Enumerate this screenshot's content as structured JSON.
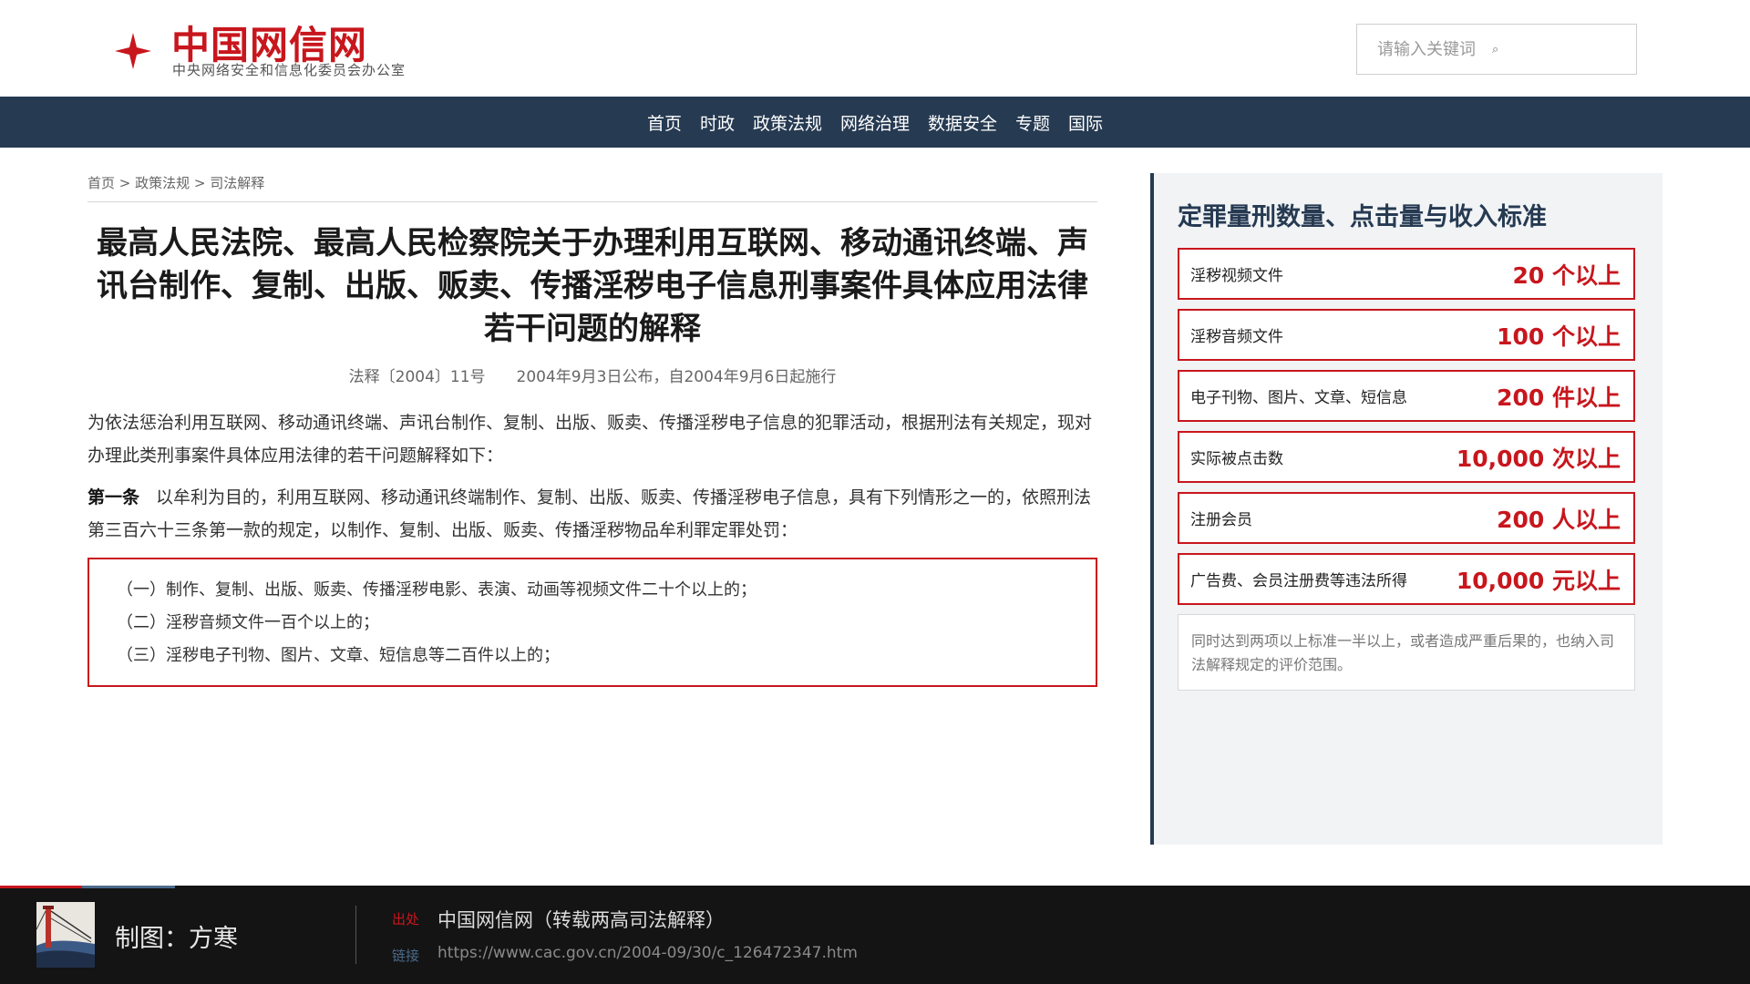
{
  "header": {
    "site_title": "中国网信网",
    "site_subtitle": "中央网络安全和信息化委员会办公室",
    "search_placeholder": "请输入关键词",
    "search_icon": "⌕"
  },
  "nav": {
    "items": [
      "首页",
      "时政",
      "政策法规",
      "网络治理",
      "数据安全",
      "专题",
      "国际"
    ]
  },
  "breadcrumb": {
    "items": [
      "首页",
      "政策法规",
      "司法解释"
    ],
    "separator": " > "
  },
  "article": {
    "title": "最高人民法院、最高人民检察院关于办理利用互联网、移动通讯终端、声讯台制作、复制、出版、贩卖、传播淫秽电子信息刑事案件具体应用法律若干问题的解释",
    "doc_number": "法释〔2004〕11号",
    "date_info": "2004年9月3日公布，自2004年9月6日起施行",
    "intro": "为依法惩治利用互联网、移动通讯终端、声讯台制作、复制、出版、贩卖、传播淫秽电子信息的犯罪活动，根据刑法有关规定，现对办理此类刑事案件具体应用法律的若干问题解释如下：",
    "article1_label": "第一条",
    "article1_text": "以牟利为目的，利用互联网、移动通讯终端制作、复制、出版、贩卖、传播淫秽电子信息，具有下列情形之一的，依照刑法第三百六十三条第一款的规定，以制作、复制、出版、贩卖、传播淫秽物品牟利罪定罪处罚：",
    "items": [
      "（一）制作、复制、出版、贩卖、传播淫秽电影、表演、动画等视频文件二十个以上的；",
      "（二）淫秽音频文件一百个以上的；",
      "（三）淫秽电子刊物、图片、文章、短信息等二百件以上的；"
    ]
  },
  "sidebar": {
    "title": "定罪量刑数量、点击量与收入标准",
    "criteria": [
      {
        "label": "淫秽视频文件",
        "value": "20 个以上"
      },
      {
        "label": "淫秽音频文件",
        "value": "100 个以上"
      },
      {
        "label": "电子刊物、图片、文章、短信息",
        "value": "200 件以上"
      },
      {
        "label": "实际被点击数",
        "value": "10,000 次以上"
      },
      {
        "label": "注册会员",
        "value": "200 人以上"
      },
      {
        "label": "广告费、会员注册费等违法所得",
        "value": "10,000 元以上"
      }
    ],
    "note": "同时达到两项以上标准一半以上，或者造成严重后果的，也纳入司法解释规定的评价范围。"
  },
  "footer": {
    "credit": "制图：方寒",
    "source_label": "出处",
    "source": "中国网信网（转载两高司法解释）",
    "link_label": "链接",
    "link": "https://www.cac.gov.cn/2004-09/30/c_126472347.htm"
  },
  "colors": {
    "brand_red": "#c8161d",
    "nav_navy": "#263a52",
    "sidebar_bg": "#f1f3f5",
    "footer_bg": "#141414"
  }
}
